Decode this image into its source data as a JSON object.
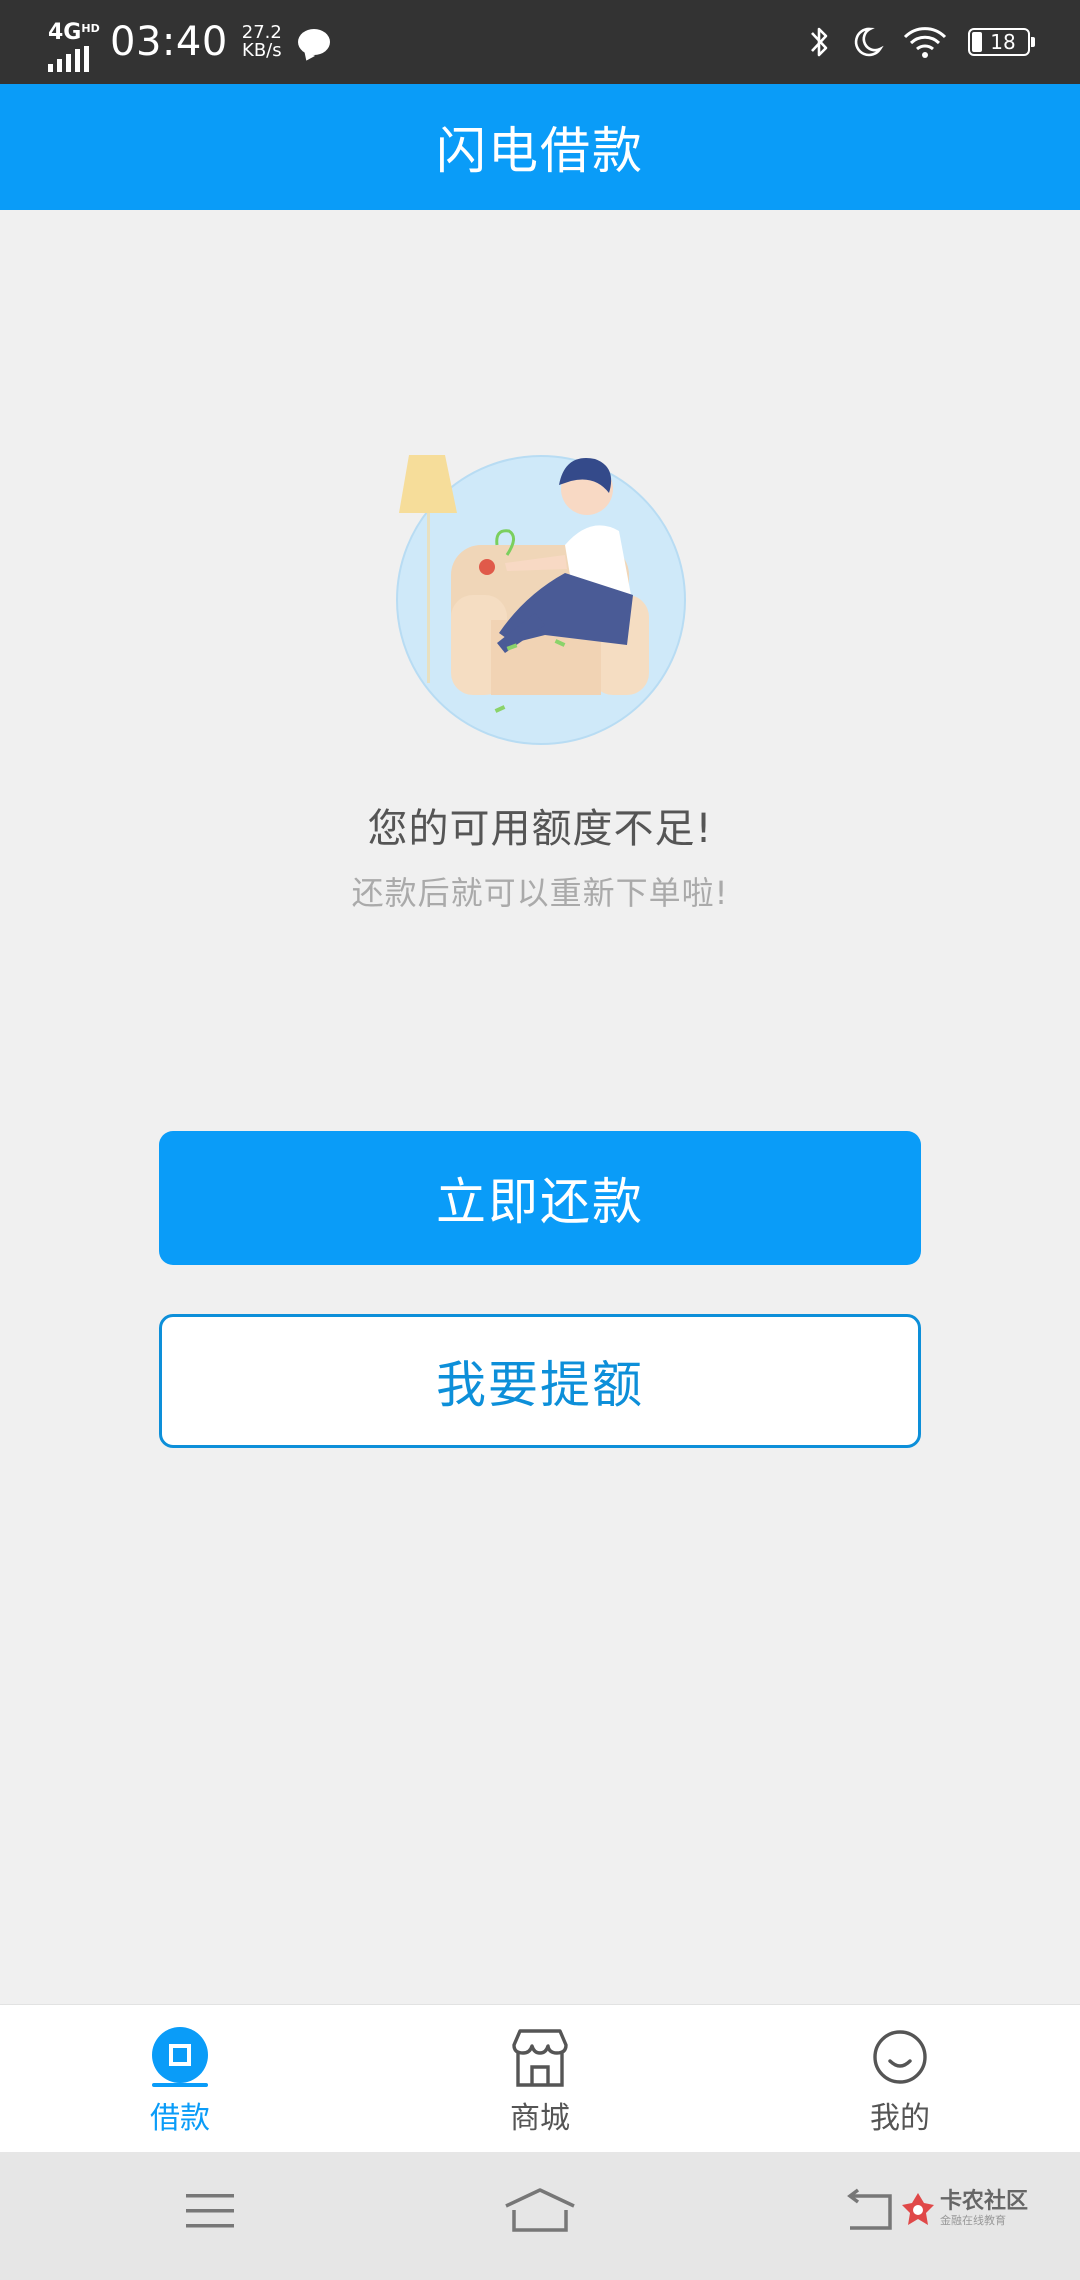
{
  "status_bar": {
    "network": "4G",
    "network_hd": "HD",
    "time": "03:40",
    "speed_value": "27.2",
    "speed_unit": "KB/s",
    "battery": "18"
  },
  "header": {
    "title": "闪电借款"
  },
  "message": {
    "main": "您的可用额度不足!",
    "sub": "还款后就可以重新下单啦!"
  },
  "buttons": {
    "repay": "立即还款",
    "raise_limit": "我要提额"
  },
  "tabs": [
    {
      "label": "借款",
      "icon": "loan-icon",
      "active": true
    },
    {
      "label": "商城",
      "icon": "store-icon",
      "active": false
    },
    {
      "label": "我的",
      "icon": "profile-icon",
      "active": false
    }
  ],
  "watermark": {
    "title": "卡农社区",
    "subtitle": "金融在线教育"
  },
  "colors": {
    "primary": "#0a9cf8",
    "outline": "#0d8fd9",
    "background": "#f0f0f0"
  }
}
